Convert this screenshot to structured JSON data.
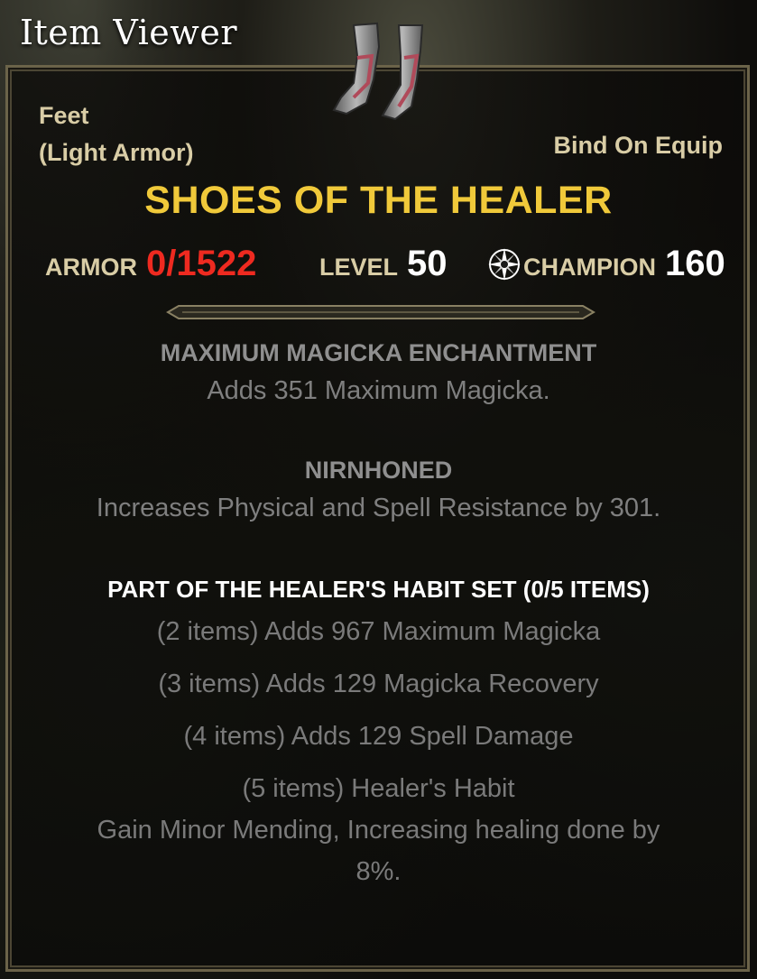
{
  "window": {
    "title": "Item Viewer"
  },
  "item": {
    "slot": "Feet",
    "armor_type": "(Light Armor)",
    "bind": "Bind On Equip",
    "name": "SHOES OF THE HEALER",
    "icon": "light-armor-boots-icon"
  },
  "stats": {
    "armor_label": "ARMOR",
    "armor_value": "0/1522",
    "level_label": "LEVEL",
    "level_value": "50",
    "champion_label": "CHAMPION",
    "champion_value": "160",
    "champion_icon": "champion-star-icon"
  },
  "enchantment": {
    "title": "MAXIMUM MAGICKA ENCHANTMENT",
    "description": "Adds 351 Maximum Magicka."
  },
  "trait": {
    "title": "NIRNHONED",
    "description": "Increases Physical and Spell Resistance by 301."
  },
  "set": {
    "title": "PART OF THE HEALER'S HABIT SET (0/5 ITEMS)",
    "bonuses": [
      "(2 items) Adds 967 Maximum Magicka",
      "(3 items) Adds 129 Magicka Recovery",
      "(4 items) Adds 129 Spell Damage",
      "(5 items) Healer's Habit"
    ],
    "final_line_1": "Gain Minor Mending, Increasing healing done by",
    "final_line_2": "8%."
  },
  "colors": {
    "title_gold": "#f0c93a",
    "label_tan": "#d9cda6",
    "armor_red": "#ee2a20",
    "frame": "#6b6349"
  }
}
